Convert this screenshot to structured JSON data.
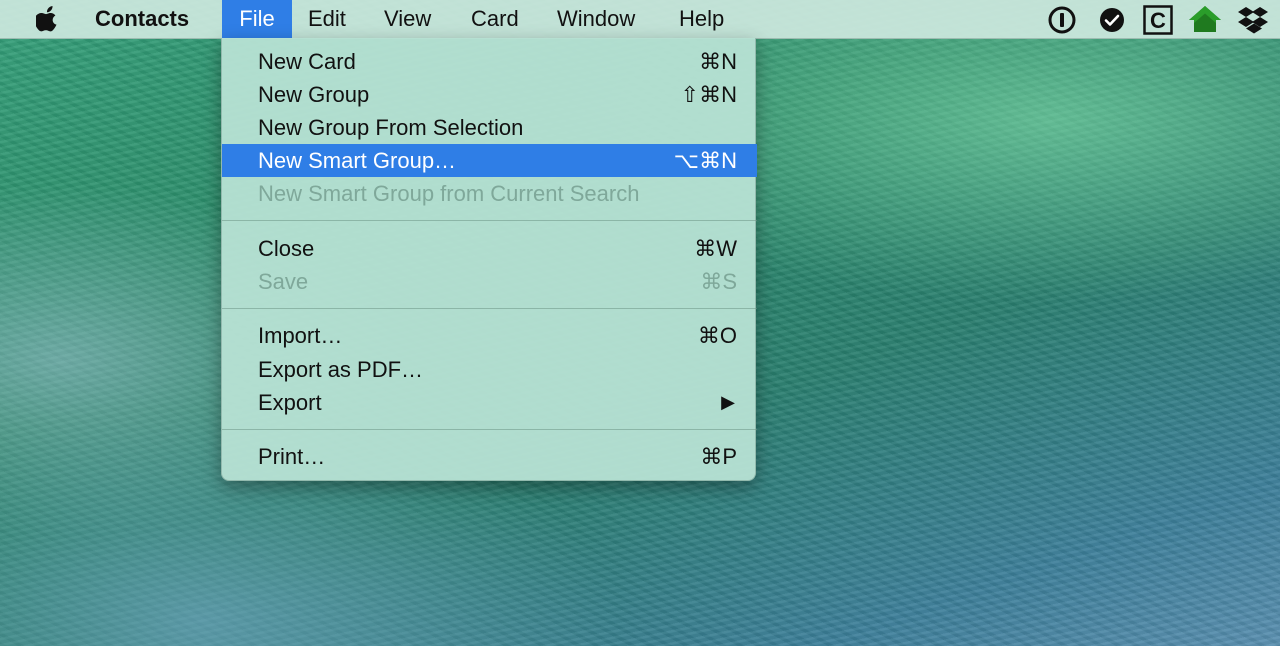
{
  "menubar": {
    "app_name": "Contacts",
    "items": [
      {
        "label": "File",
        "active": true
      },
      {
        "label": "Edit"
      },
      {
        "label": "View"
      },
      {
        "label": "Card"
      },
      {
        "label": "Window"
      },
      {
        "label": "Help"
      }
    ],
    "status_icons": [
      "1password-icon",
      "check-circle-icon",
      "c-box-icon",
      "home-icon",
      "dropbox-icon"
    ],
    "status_letter": "C"
  },
  "file_menu": {
    "items": [
      {
        "label": "New Card",
        "shortcut": "⌘N",
        "enabled": true
      },
      {
        "label": "New Group",
        "shortcut": "⇧⌘N",
        "enabled": true
      },
      {
        "label": "New Group From Selection",
        "shortcut": "",
        "enabled": true
      },
      {
        "label": "New Smart Group…",
        "shortcut": "⌥⌘N",
        "enabled": true,
        "highlighted": true
      },
      {
        "label": "New Smart Group from Current Search",
        "shortcut": "",
        "enabled": false
      },
      {
        "label": "Close",
        "shortcut": "⌘W",
        "enabled": true
      },
      {
        "label": "Save",
        "shortcut": "⌘S",
        "enabled": false
      },
      {
        "label": "Import…",
        "shortcut": "⌘O",
        "enabled": true
      },
      {
        "label": "Export as PDF…",
        "shortcut": "",
        "enabled": true
      },
      {
        "label": "Export",
        "shortcut": "▶",
        "enabled": true,
        "submenu": true
      },
      {
        "label": "Print…",
        "shortcut": "⌘P",
        "enabled": true
      }
    ]
  },
  "colors": {
    "highlight": "#2f7ee6",
    "menu_background": "#b7e2d4",
    "disabled_text": "#7fa89a"
  }
}
